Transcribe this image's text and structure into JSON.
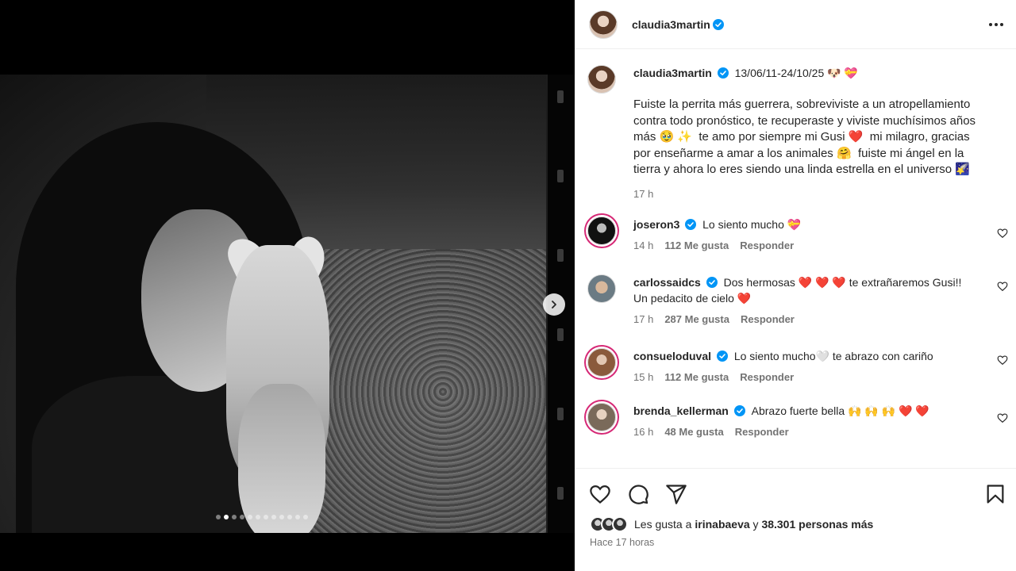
{
  "post": {
    "author": "claudia3martin",
    "carousel": {
      "total_slides": 12,
      "active_index": 1
    }
  },
  "caption": {
    "username": "claudia3martin",
    "dates": "13/06/11-24/10/25 🐶 💝",
    "text": "Fuiste la perrita más guerrera, sobreviviste a un atropellamiento contra todo pronóstico, te recuperaste y viviste muchísimos años más 🥹 ✨  te amo por siempre mi Gusi ❤️  mi milagro, gracias por enseñarme a amar a los animales 🤗  fuiste mi ángel en la tierra y ahora lo eres siendo una linda estrella en el universo 🌠",
    "time": "17 h"
  },
  "comments": [
    {
      "username": "joseron3",
      "text": "Lo siento mucho 💝",
      "time": "14 h",
      "likes": "112 Me gusta",
      "reply": "Responder"
    },
    {
      "username": "carlossaidcs",
      "text": "Dos hermosas ❤️ ❤️ ❤️  te extrañaremos Gusi!! Un pedacito de cielo ❤️",
      "time": "17 h",
      "likes": "287 Me gusta",
      "reply": "Responder"
    },
    {
      "username": "consueloduval",
      "text": "Lo siento mucho🤍  te abrazo con cariño",
      "time": "15 h",
      "likes": "112 Me gusta",
      "reply": "Responder"
    },
    {
      "username": "brenda_kellerman",
      "text": "Abrazo fuerte bella 🙌 🙌 🙌 ❤️ ❤️",
      "time": "16 h",
      "likes": "48 Me gusta",
      "reply": "Responder"
    }
  ],
  "likes": {
    "prefix": "Les gusta a ",
    "first_user": "irinabaeva",
    "connector": " y ",
    "others": "38.301 personas más"
  },
  "timestamp": "Hace 17 horas",
  "colors": {
    "verified": "#0095f6",
    "text": "#262626",
    "secondary": "#737373",
    "story_ring": "#d62976"
  }
}
